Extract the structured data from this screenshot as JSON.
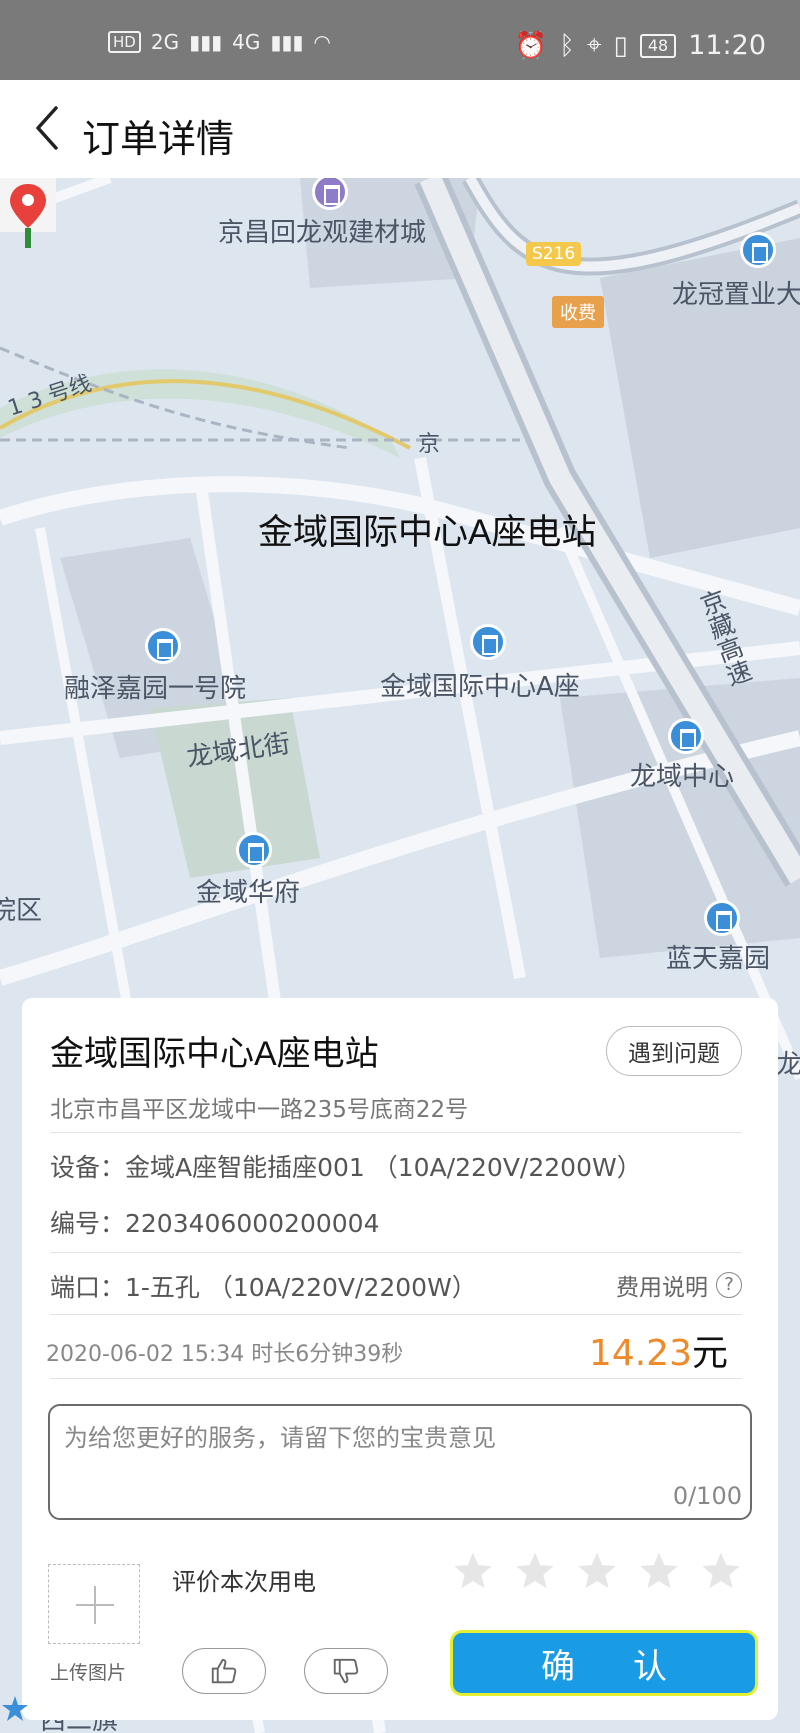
{
  "status_bar": {
    "left_badges": [
      "HD",
      "2G",
      "4G"
    ],
    "battery": "48",
    "time": "11:20"
  },
  "header": {
    "title": "订单详情"
  },
  "map": {
    "station_label": "金域国际中心A座电站",
    "road_shield": "S216",
    "toll_tag": "收费",
    "labels": {
      "building_materials": "京昌回龙观建材城",
      "longguan": "龙冠置业大",
      "line13": "1 3 号线",
      "jing": "京",
      "rongze": "融泽嘉园一号院",
      "jinyu_a": "金域国际中心A座",
      "jingzang": "京藏高速",
      "longyu_north": "龙域北街",
      "longyu_center": "龙域中心",
      "jinyu_huafu": "金域华府",
      "yuan_qu": "院区",
      "lantian": "蓝天嘉园",
      "bottom_road": "西二旗",
      "right_long": "龙"
    }
  },
  "card": {
    "title": "金域国际中心A座电站",
    "issue_button": "遇到问题",
    "address": "北京市昌平区龙域中一路235号底商22号",
    "device": "设备：金域A座智能插座001 （10A/220V/2200W）",
    "serial": "编号：2203406000200004",
    "port": "端口：1-五孔 （10A/220V/2200W）",
    "fee_link": "费用说明",
    "help_glyph": "?",
    "time_info": "2020-06-02 15:34  时长6分钟39秒",
    "price_value": "14.23",
    "price_unit": "元",
    "feedback_placeholder": "为给您更好的服务，请留下您的宝贵意见",
    "counter": "0/100",
    "upload_label": "上传图片",
    "rate_label": "评价本次用电",
    "rating": 0,
    "confirm_button": "确认"
  },
  "colors": {
    "accent_blue": "#1a9be6",
    "price_orange": "#ee8a2a",
    "confirm_border": "#e3ef31"
  },
  "icons": [
    "back-icon",
    "map-pin-icon",
    "poi-building-icon",
    "star-icon",
    "thumbs-up-icon",
    "thumbs-down-icon",
    "help-icon",
    "plus-icon"
  ]
}
